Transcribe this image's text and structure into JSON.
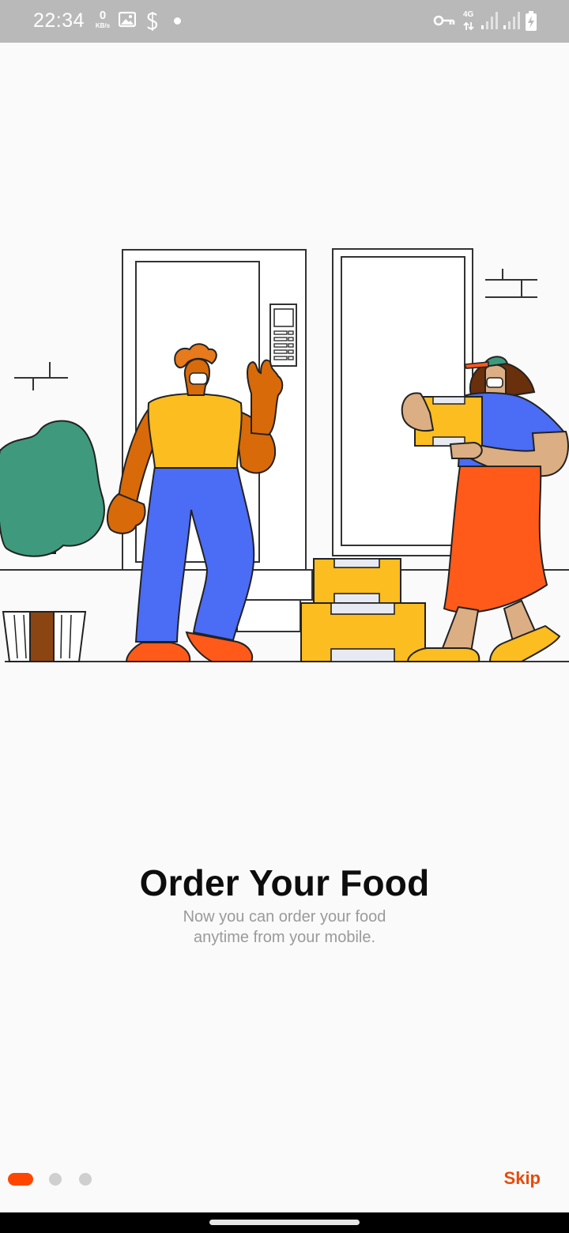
{
  "status_bar": {
    "time": "22:34",
    "net_speed_value": "0",
    "net_speed_unit": "KB/s",
    "network_type": "4G",
    "icons": [
      "image-icon",
      "sync-icon",
      "notification-dot",
      "vpn-key-icon",
      "signal-icon",
      "signal-icon",
      "battery-charging-icon"
    ]
  },
  "onboarding": {
    "title": "Order Your Food",
    "subtitle_line1": "Now you can order your food",
    "subtitle_line2": "anytime from your mobile.",
    "illustration": "food-delivery-illustration",
    "pages_total": 3,
    "current_page": 1,
    "skip_label": "Skip"
  },
  "colors": {
    "accent": "#ff4500",
    "skip_text": "#e84a0a",
    "dot_inactive": "#cfcfcf",
    "title": "#0d0d0d",
    "subtitle": "#9a9a9a",
    "background": "#fafafa"
  }
}
